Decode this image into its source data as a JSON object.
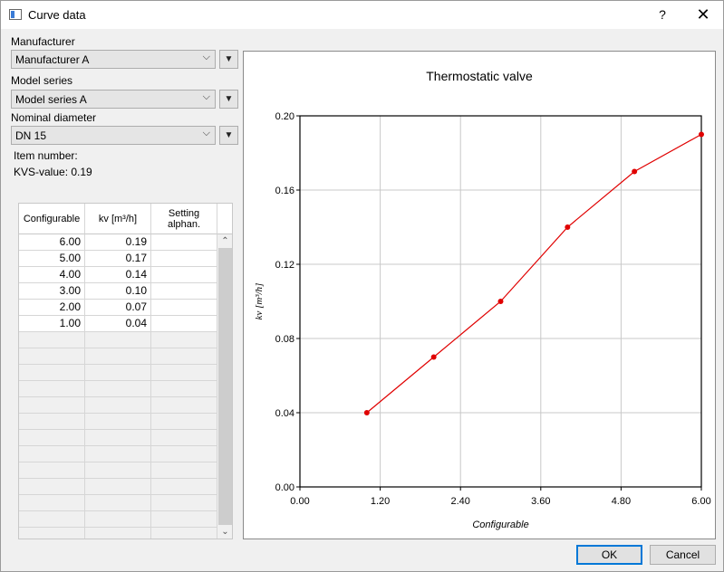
{
  "window": {
    "title": "Curve data",
    "help": "?",
    "close": "✕"
  },
  "form": {
    "manufacturer_label": "Manufacturer",
    "manufacturer_value": "Manufacturer A",
    "model_label": "Model series",
    "model_value": "Model series A",
    "diameter_label": "Nominal diameter",
    "diameter_value": "DN 15",
    "item_number": "Item number:",
    "kvs_value": "KVS-value: 0.19",
    "combo_arrow": "⌵",
    "side_arrow": "▼"
  },
  "table": {
    "headers": [
      "Configurable",
      "kv [m³/h]",
      "Setting alphan."
    ],
    "rows": [
      [
        "6.00",
        "0.19",
        ""
      ],
      [
        "5.00",
        "0.17",
        ""
      ],
      [
        "4.00",
        "0.14",
        ""
      ],
      [
        "3.00",
        "0.10",
        ""
      ],
      [
        "2.00",
        "0.07",
        ""
      ],
      [
        "1.00",
        "0.04",
        ""
      ]
    ],
    "empty_rows": 13,
    "scroll_up": "⌃",
    "scroll_down": "⌄"
  },
  "chart_data": {
    "type": "line",
    "title": "Thermostatic valve",
    "xlabel": "Configurable",
    "ylabel": "kv [m³/h]",
    "x": [
      1,
      2,
      3,
      4,
      5,
      6
    ],
    "y": [
      0.04,
      0.07,
      0.1,
      0.14,
      0.17,
      0.19
    ],
    "xlim": [
      0,
      6
    ],
    "ylim": [
      0,
      0.2
    ],
    "xticks": [
      "0.00",
      "1.20",
      "2.40",
      "3.60",
      "4.80",
      "6.00"
    ],
    "yticks": [
      "0.00",
      "0.04",
      "0.08",
      "0.12",
      "0.16",
      "0.20"
    ],
    "grid": true,
    "color": "#e00000"
  },
  "buttons": {
    "ok": "OK",
    "cancel": "Cancel"
  }
}
